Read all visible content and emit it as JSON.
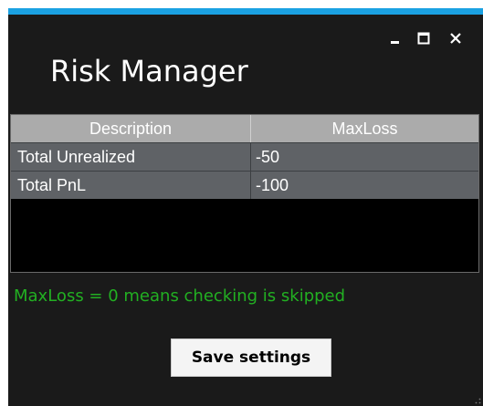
{
  "window": {
    "title": "Risk Manager",
    "accent_color": "#1ba1e2",
    "buttons": {
      "minimize_icon": "minimize-icon",
      "maximize_icon": "maximize-icon",
      "close_icon": "close-icon"
    }
  },
  "grid": {
    "columns": [
      "Description",
      "MaxLoss"
    ],
    "rows": [
      {
        "description": "Total Unrealized",
        "maxloss": "-50"
      },
      {
        "description": "Total PnL",
        "maxloss": "-100"
      }
    ]
  },
  "info": {
    "text": "MaxLoss = 0 means checking is skipped",
    "color": "#22b022"
  },
  "actions": {
    "save_label": "Save settings"
  }
}
